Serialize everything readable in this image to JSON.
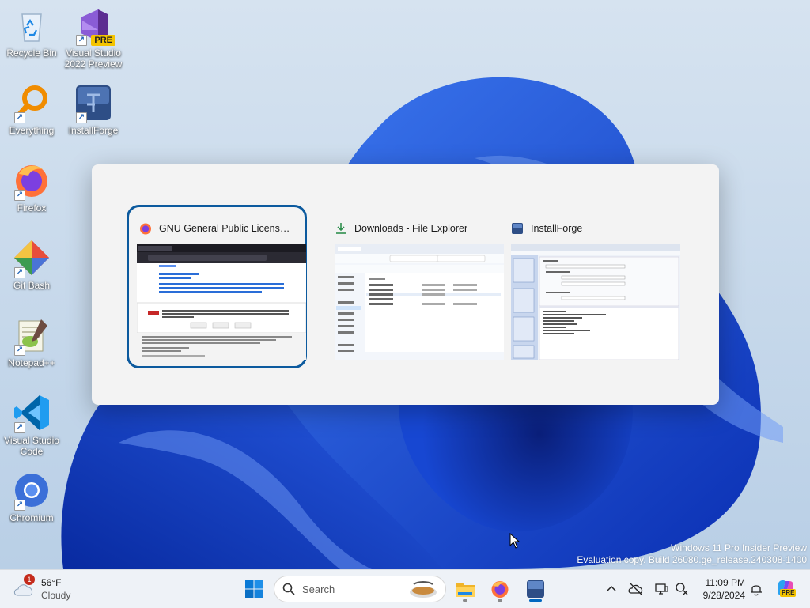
{
  "desktop": {
    "icons": [
      {
        "label": "Recycle Bin",
        "icon": "recycle-bin-icon"
      },
      {
        "label": "Visual Studio 2022 Preview",
        "icon": "visual-studio-icon",
        "badge": "PRE"
      },
      {
        "label": "Everything",
        "icon": "everything-icon"
      },
      {
        "label": "InstallForge",
        "icon": "installforge-icon"
      },
      {
        "label": "Firefox",
        "icon": "firefox-icon"
      },
      {
        "label": "Git Bash",
        "icon": "git-bash-icon"
      },
      {
        "label": "Notepad++",
        "icon": "notepadpp-icon"
      },
      {
        "label": "Visual Studio Code",
        "icon": "vscode-icon"
      },
      {
        "label": "Chromium",
        "icon": "chromium-icon"
      }
    ]
  },
  "switcher": {
    "tasks": [
      {
        "title": "GNU General Public License v...",
        "icon": "firefox-icon",
        "selected": true
      },
      {
        "title": "Downloads - File Explorer",
        "icon": "download-icon",
        "selected": false
      },
      {
        "title": "InstallForge",
        "icon": "installforge-icon",
        "selected": false
      }
    ]
  },
  "watermark": {
    "line1": "Windows 11 Pro Insider Preview",
    "line2": "Evaluation copy. Build 26080.ge_release.240308-1400"
  },
  "taskbar": {
    "weather": {
      "temp": "56°F",
      "condition": "Cloudy",
      "badge": "1"
    },
    "search_placeholder": "Search",
    "clock": {
      "time": "11:09 PM",
      "date": "9/28/2024"
    },
    "copilot_badge": "PRE"
  },
  "colors": {
    "accent": "#0067c0",
    "selection": "#0c5a9e",
    "wallpaper_blue": "#1a4fd8"
  }
}
